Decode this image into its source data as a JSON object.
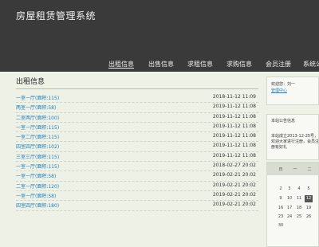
{
  "header": {
    "site_title": "房屋租赁管理系统"
  },
  "nav": {
    "items": [
      {
        "label": "出租信息"
      },
      {
        "label": "出售信息"
      },
      {
        "label": "求租信息"
      },
      {
        "label": "求购信息"
      },
      {
        "label": "会员注册"
      },
      {
        "label": "系统公"
      }
    ]
  },
  "main": {
    "section_title": "出租信息",
    "rows": [
      {
        "title": "一室一厅(面积:115)",
        "date": "2018-11-12 11:09"
      },
      {
        "title": "两室一厅(面积:58)",
        "date": "2019-11-12 11:08"
      },
      {
        "title": "二室两厅(面积:100)",
        "date": "2019-11-12 11:08"
      },
      {
        "title": "一室一厅(面积:115)",
        "date": "2019-11-12 11:08"
      },
      {
        "title": "一室二厅(面积:115)",
        "date": "2019-11-12 11:08"
      },
      {
        "title": "四室四厅(面积:102)",
        "date": "2019-11-12 11:08"
      },
      {
        "title": "三室三厅(面积:115)",
        "date": "2019-11-12 11:08"
      },
      {
        "title": "一室一厅(面积:115)",
        "date": "2018-02-27 20:02"
      },
      {
        "title": "一室一厅(面积:58)",
        "date": "2019-02-21 20:02"
      },
      {
        "title": "二室一厅(面积:120)",
        "date": "2019-02-21 20:02"
      },
      {
        "title": "一室一厅(面积:58)",
        "date": "2019-02-21 20:02"
      },
      {
        "title": "四室四厅(面积:180)",
        "date": "2019-02-21 20:02"
      }
    ]
  },
  "sidebar": {
    "login": {
      "welcome": "欢迎您：刘一",
      "link": "管理中心"
    },
    "notice": {
      "title": "本站公告信息",
      "body": "本站成立2013-12-25号，欢迎大家进行注册，会员注册有好礼"
    },
    "calendar": {
      "weekdays": [
        "日",
        "一",
        "二",
        "三"
      ],
      "weeks": [
        [
          "",
          "",
          "",
          ""
        ],
        [
          "2",
          "3",
          "4",
          "5"
        ],
        [
          "9",
          "10",
          "11",
          "12"
        ],
        [
          "16",
          "17",
          "18",
          "19"
        ],
        [
          "23",
          "24",
          "25",
          "26"
        ],
        [
          "30",
          "",
          "",
          ""
        ]
      ],
      "today": "12"
    }
  }
}
